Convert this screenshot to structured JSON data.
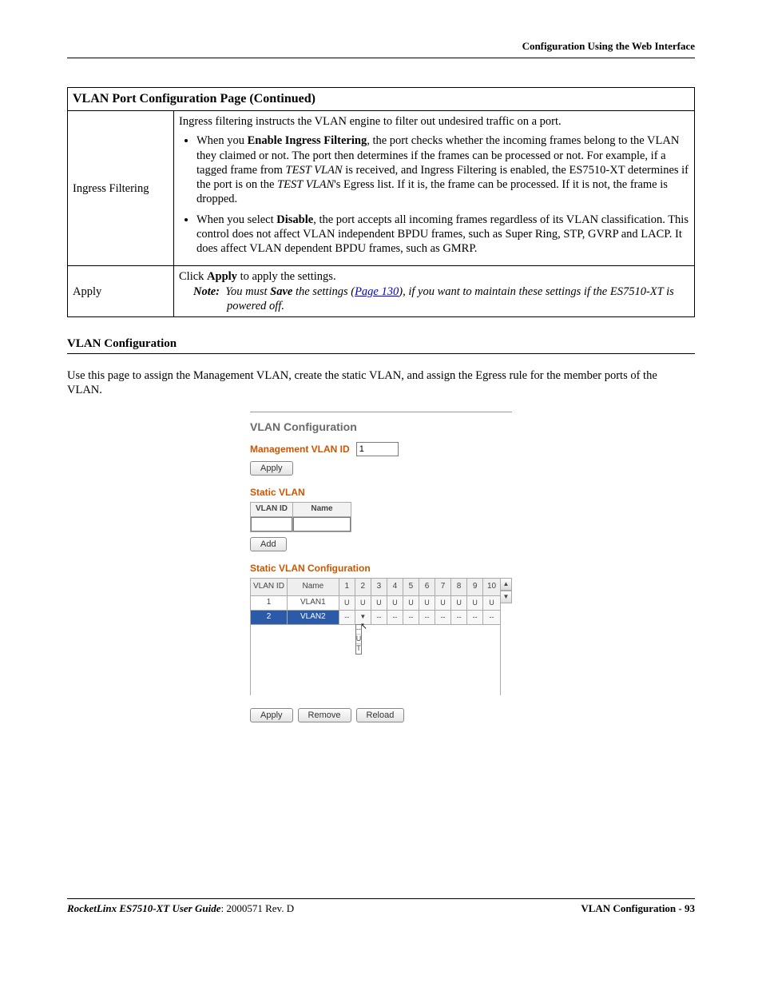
{
  "header": {
    "right": "Configuration Using the Web Interface"
  },
  "table": {
    "title": "VLAN Port Configuration Page  (Continued)",
    "rows": [
      {
        "label": "Ingress Filtering",
        "intro": "Ingress filtering instructs the VLAN engine to filter out undesired traffic on a port.",
        "b1_pre": "When you ",
        "b1_bold": "Enable Ingress Filtering",
        "b1_mid1": ", the port checks whether the incoming frames belong to the VLAN they claimed or not. The port then determines if the frames can be processed or not. For example, if a tagged frame from ",
        "b1_em1": "TEST VLAN",
        "b1_mid2": " is received, and Ingress Filtering is enabled, the ES7510-XT determines if the port is on the ",
        "b1_em2": "TEST VLAN",
        "b1_post": "'s Egress list. If it is, the frame can be processed. If it is not, the frame is dropped.",
        "b2_pre": "When you select ",
        "b2_bold": "Disable",
        "b2_post": ", the port accepts all incoming frames regardless of its VLAN classification. This control does not affect VLAN independent BPDU frames, such as Super Ring, STP, GVRP and LACP. It does affect VLAN dependent BPDU frames, such as GMRP."
      },
      {
        "label": "Apply",
        "line1_pre": "Click ",
        "line1_bold": "Apply",
        "line1_post": " to apply the settings.",
        "note_label": "Note:",
        "note_pre": "You must ",
        "note_bold": "Save",
        "note_mid": " the settings (",
        "note_link": "Page 130",
        "note_post": "), if you want to maintain these settings if the ES7510-XT is powered off."
      }
    ]
  },
  "section": {
    "title": "VLAN Configuration",
    "intro": "Use this page to assign the Management VLAN, create the static VLAN, and assign the Egress rule for the member ports of the VLAN."
  },
  "screenshot": {
    "title": "VLAN Configuration",
    "mgmt_label": "Management VLAN ID",
    "mgmt_value": "1",
    "apply": "Apply",
    "static_title": "Static VLAN",
    "th_vlanid": "VLAN ID",
    "th_name": "Name",
    "add": "Add",
    "svc_title": "Static VLAN Configuration",
    "ports": [
      "1",
      "2",
      "3",
      "4",
      "5",
      "6",
      "7",
      "8",
      "9",
      "10"
    ],
    "row1": {
      "id": "1",
      "name": "VLAN1",
      "cells": [
        "U",
        "U",
        "U",
        "U",
        "U",
        "U",
        "U",
        "U",
        "U",
        "U"
      ]
    },
    "row2": {
      "id": "2",
      "name": "VLAN2",
      "cells": [
        "--",
        "",
        "--",
        "--",
        "--",
        "--",
        "--",
        "--",
        "--",
        "--"
      ]
    },
    "dd": {
      "opt1": "--",
      "opt2": "U",
      "opt3": "T"
    },
    "remove": "Remove",
    "reload": "Reload"
  },
  "footer": {
    "left_em": "RocketLinx ES7510-XT  User Guide",
    "left_rest": ": 2000571 Rev. D",
    "right_bold": "VLAN Configuration - 93"
  }
}
